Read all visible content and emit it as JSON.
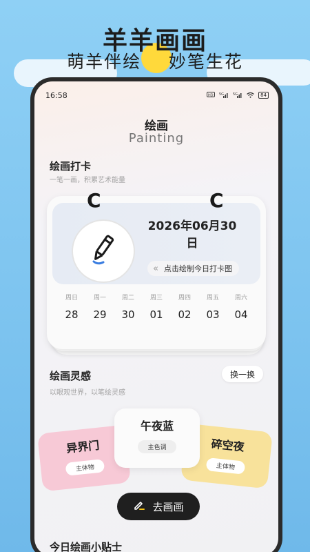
{
  "promo": {
    "title": "羊羊画画",
    "subtitle": "萌羊伴绘    妙笔生花"
  },
  "status_bar": {
    "time": "16:58",
    "icons": [
      "hd-icon",
      "5g-signal-icon",
      "5g-signal-icon",
      "wifi-icon",
      "battery-icon"
    ],
    "battery": "84"
  },
  "header": {
    "title": "绘画",
    "subtitle": "Painting"
  },
  "checkin": {
    "title": "绘画打卡",
    "desc": "一笔一画，积累艺术能量",
    "date": "2026年06月30日",
    "hint": "点击绘制今日打卡图",
    "week": [
      {
        "label": "周日",
        "num": "28"
      },
      {
        "label": "周一",
        "num": "29"
      },
      {
        "label": "周二",
        "num": "30"
      },
      {
        "label": "周三",
        "num": "01"
      },
      {
        "label": "周四",
        "num": "02"
      },
      {
        "label": "周五",
        "num": "03"
      },
      {
        "label": "周六",
        "num": "04"
      }
    ]
  },
  "inspiration": {
    "title": "绘画灵感",
    "desc": "以眼观世界，以笔绘灵感",
    "swap": "换一换",
    "cards": [
      {
        "title": "异界门",
        "tag": "主体物",
        "color": "#f7c9d6"
      },
      {
        "title": "午夜蓝",
        "tag": "主色调",
        "color": "#fbfbfb"
      },
      {
        "title": "碎空夜",
        "tag": "主体物",
        "color": "#f8e29b"
      }
    ],
    "go": "去画画"
  },
  "tips": {
    "title": "今日绘画小贴士"
  }
}
